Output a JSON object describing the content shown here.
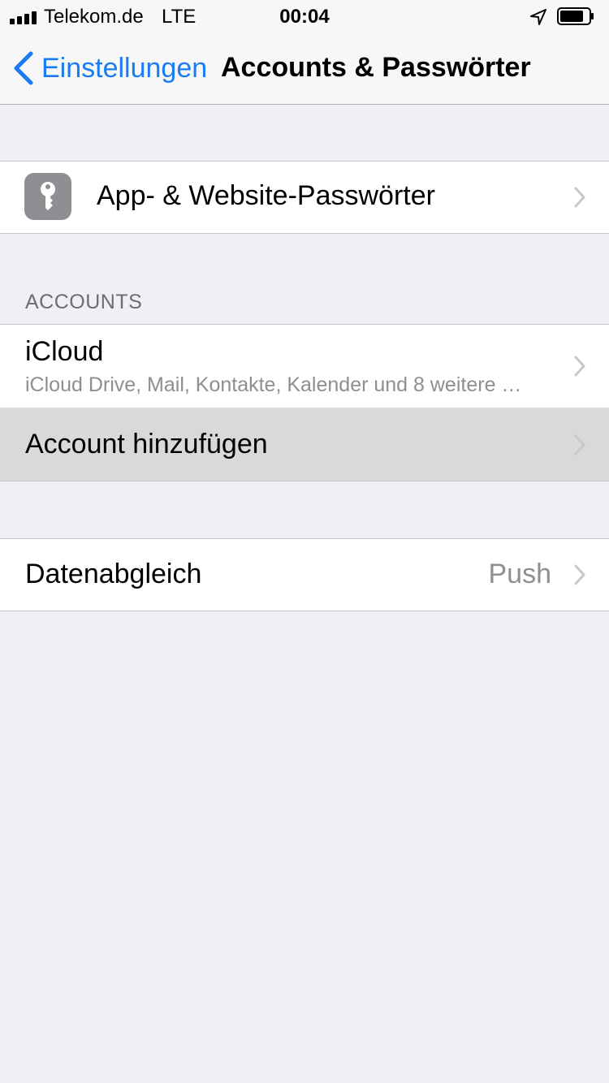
{
  "statusbar": {
    "carrier": "Telekom.de",
    "network": "LTE",
    "time": "00:04"
  },
  "navbar": {
    "back_label": "Einstellungen",
    "title": "Accounts & Passwörter"
  },
  "passwords_row": {
    "label": "App- & Website-Passwörter",
    "icon": "key-icon"
  },
  "accounts_section": {
    "header": "ACCOUNTS",
    "icloud": {
      "title": "iCloud",
      "subtitle": "iCloud Drive, Mail, Kontakte, Kalender und 8 weitere …"
    },
    "add_account": "Account hinzufügen"
  },
  "fetch_row": {
    "label": "Datenabgleich",
    "value": "Push"
  },
  "colors": {
    "accent": "#1a7cf5",
    "background": "#efeff4",
    "highlight": "#d9d9d9"
  }
}
